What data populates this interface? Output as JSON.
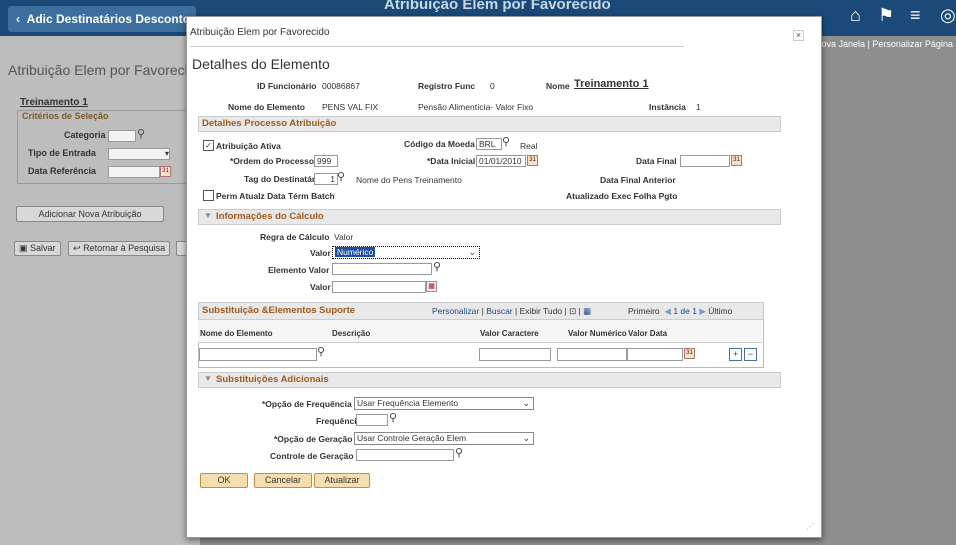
{
  "banner": {
    "back_label": "Adic Destinatários Descontos",
    "title": "Atribuição Elem por Favorecido",
    "icons": [
      "home-icon",
      "flag-icon",
      "menu-icon",
      "navbar-icon"
    ]
  },
  "background": {
    "links": "Nova Janela | Personalizar Página |",
    "page_title": "Atribuição Elem por Favorecido",
    "employee_name": "Treinamento 1",
    "criteria_title": "Critérios de Seleção",
    "category_label": "Categoria",
    "entry_type_label": "Tipo de Entrada",
    "ref_date_label": "Data Referência",
    "add_button": "Adicionar Nova Atribuição",
    "save_button": "Salvar",
    "return_button": "Retornar à Pesquisa"
  },
  "modal": {
    "title": "Atribuição Elem por Favorecido",
    "close_label": "×",
    "section_title": "Detalhes do Elemento",
    "emp_id_label": "ID Funcionário",
    "emp_id_value": "00086867",
    "emp_rec_label": "Registro Func",
    "emp_rec_value": "0",
    "name_label": "Nome",
    "name_value": "Treinamento 1",
    "element_name_label": "Nome do Elemento",
    "element_name_value": "PENS VAL FIX",
    "element_desc": "Pensão Alimentícia- Valor Fixo",
    "instance_label": "Instância",
    "instance_value": "1"
  },
  "details": {
    "header": "Detalhes Processo Atribuição",
    "active_label": "Atribuição Ativa",
    "active_checked": true,
    "currency_label": "Código da Moeda",
    "currency_value": "BRL",
    "currency_name": "Real",
    "order_label": "*Ordem do Processo",
    "order_value": "999",
    "start_date_label": "*Data Inicial",
    "start_date_value": "01/01/2010",
    "end_date_label": "Data Final",
    "end_date_value": "",
    "recipient_tag_label": "Tag do Destinatário",
    "recipient_tag_value": "1",
    "recipient_name": "Nome do Pens Treinamento",
    "prev_end_date_label": "Data Final Anterior",
    "batch_label": "Perm Atualz Data Térm Batch",
    "batch_checked": false,
    "payroll_update_label": "Atualizado Exec Folha Pgto"
  },
  "calc": {
    "header": "Informações do Cálculo",
    "rule_label": "Regra de Cálculo",
    "rule_value": "Valor",
    "value_type_label": "Valor",
    "value_type_selected": "Numérico",
    "element_value_label": "Elemento Valor",
    "element_value_value": "",
    "value_label": "Valor",
    "value_value": ""
  },
  "support_grid": {
    "header": "Substituição &Elementos Suporte",
    "personalize": "Personalizar",
    "find": "Buscar",
    "view_all": "Exibir Tudo",
    "first": "Primeiro",
    "range": "1 de 1",
    "last": "Último",
    "columns": [
      "Nome do Elemento",
      "Descrição",
      "Valor Caractere",
      "Valor Numérico",
      "Valor Data"
    ],
    "add_label": "+",
    "delete_label": "−"
  },
  "additional": {
    "header": "Substituições Adicionais",
    "freq_option_label": "*Opção de Frequência",
    "freq_option_value": "Usar Frequência Elemento",
    "frequency_label": "Frequência",
    "frequency_value": "",
    "gen_option_label": "*Opção de Geração",
    "gen_option_value": "Usar Controle Geração Elem",
    "gen_control_label": "Controle de Geração",
    "gen_control_value": ""
  },
  "buttons": {
    "ok": "OK",
    "cancel": "Cancelar",
    "update": "Atualizar"
  },
  "colors": {
    "banner": "#1b4a79",
    "section_title": "#a05a1c",
    "link": "#1d4b87",
    "selected": "#1d4fa0"
  }
}
